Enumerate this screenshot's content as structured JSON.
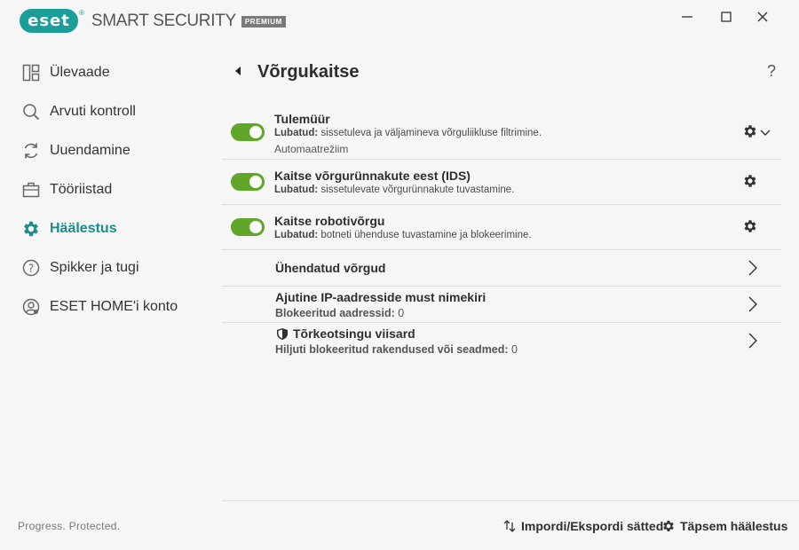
{
  "app": {
    "logo_text": "eset",
    "logo_reg": "®",
    "product": "SMART SECURITY",
    "edition": "PREMIUM",
    "accent_color": "#1b9d9a",
    "toggle_color": "#5fa62a"
  },
  "window_controls": {
    "minimize": "—",
    "maximize": "☐",
    "close": "✕"
  },
  "sidebar": {
    "items": [
      {
        "label": "Ülevaade",
        "icon": "overview-icon",
        "active": false
      },
      {
        "label": "Arvuti kontroll",
        "icon": "search-icon",
        "active": false
      },
      {
        "label": "Uuendamine",
        "icon": "refresh-icon",
        "active": false
      },
      {
        "label": "Tööriistad",
        "icon": "briefcase-icon",
        "active": false
      },
      {
        "label": "Häälestus",
        "icon": "gear-icon",
        "active": true
      },
      {
        "label": "Spikker ja tugi",
        "icon": "help-icon",
        "active": false
      },
      {
        "label": "ESET HOME'i konto",
        "icon": "account-icon",
        "active": false
      }
    ],
    "footer": "Progress. Protected."
  },
  "main": {
    "title": "Võrgukaitse",
    "help": "?",
    "features": [
      {
        "title": "Tulemüür",
        "desc_label": "Lubatud:",
        "desc": " sissetuleva ja väljamineva võrguliikluse filtrimine.",
        "sub": "Automaatrežiim",
        "enabled": true
      },
      {
        "title": "Kaitse võrgurünnakute eest (IDS)",
        "desc_label": "Lubatud:",
        "desc": " sissetulevate võrgurünnakute tuvastamine.",
        "enabled": true
      },
      {
        "title": "Kaitse robotivõrgu",
        "desc_label": "Lubatud:",
        "desc": " botneti ühenduse tuvastamine ja blokeerimine.",
        "enabled": true
      }
    ],
    "links": [
      {
        "title": "Ühendatud võrgud"
      },
      {
        "title": "Ajutine IP-aadresside must nimekiri",
        "sub_label": "Blokeeritud aadressid:",
        "sub_value": " 0"
      },
      {
        "title": "Tõrkeotsingu viisard",
        "sub_label": "Hiljuti blokeeritud rakendused või seadmed:",
        "sub_value": " 0"
      }
    ]
  },
  "bottom": {
    "import_export": "Impordi/Ekspordi sätted",
    "advanced": "Täpsem häälestus"
  }
}
